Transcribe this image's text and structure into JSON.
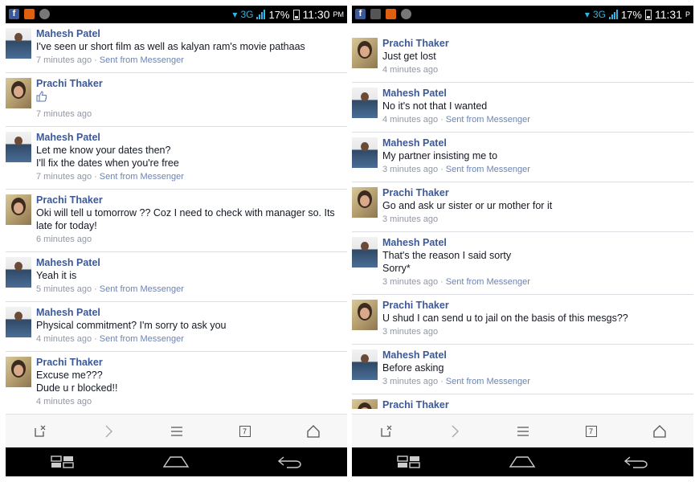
{
  "left_panel": {
    "status": {
      "network": "3G",
      "battery": "17%",
      "time": "11:30",
      "ampm": "PM"
    },
    "messages": [
      {
        "author": "Mahesh Patel",
        "avatar": "mahesh",
        "text": "I've seen ur short film as well as kalyan ram's movie pathaas",
        "time": "7 minutes ago",
        "source": "Sent from Messenger"
      },
      {
        "author": "Prachi Thaker",
        "avatar": "prachi",
        "like": true,
        "time": "7 minutes ago"
      },
      {
        "author": "Mahesh Patel",
        "avatar": "mahesh",
        "text": "Let me know your dates then?\nI'll fix the dates when you're free",
        "time": "7 minutes ago",
        "source": "Sent from Messenger"
      },
      {
        "author": "Prachi Thaker",
        "avatar": "prachi",
        "text": "Oki will tell u tomorrow ?? Coz I need to check with manager so. Its late for today!",
        "time": "6 minutes ago"
      },
      {
        "author": "Mahesh Patel",
        "avatar": "mahesh",
        "text": "Yeah it is",
        "time": "5 minutes ago",
        "source": "Sent from Messenger"
      },
      {
        "author": "Mahesh Patel",
        "avatar": "mahesh",
        "text": "Physical commitment? I'm sorry to ask you",
        "time": "4 minutes ago",
        "source": "Sent from Messenger"
      },
      {
        "author": "Prachi Thaker",
        "avatar": "prachi",
        "text": "Excuse me???\nDude u r blocked!!",
        "time": "4 minutes ago"
      }
    ],
    "toolbar": {
      "tabs_count": "7"
    }
  },
  "right_panel": {
    "status": {
      "network": "3G",
      "battery": "17%",
      "time": "11:31",
      "ampm": "P"
    },
    "messages": [
      {
        "author": "Prachi Thaker",
        "avatar": "prachi",
        "text": "Just get lost",
        "time": "4 minutes ago"
      },
      {
        "author": "Mahesh Patel",
        "avatar": "mahesh",
        "text": "No it's not that I wanted",
        "time": "4 minutes ago",
        "source": "Sent from Messenger"
      },
      {
        "author": "Mahesh Patel",
        "avatar": "mahesh",
        "text": "My partner insisting me to",
        "time": "3 minutes ago",
        "source": "Sent from Messenger"
      },
      {
        "author": "Prachi Thaker",
        "avatar": "prachi",
        "text": "Go and ask ur sister or ur mother for it",
        "time": "3 minutes ago"
      },
      {
        "author": "Mahesh Patel",
        "avatar": "mahesh",
        "text": "That's the reason I said sorty\nSorry*",
        "time": "3 minutes ago",
        "source": "Sent from Messenger"
      },
      {
        "author": "Prachi Thaker",
        "avatar": "prachi",
        "text": "U shud I can send u to jail on the basis of this mesgs??",
        "time": "3 minutes ago"
      },
      {
        "author": "Mahesh Patel",
        "avatar": "mahesh",
        "text": "Before asking",
        "time": "3 minutes ago",
        "source": "Sent from Messenger"
      },
      {
        "author": "Prachi Thaker",
        "avatar": "prachi"
      }
    ],
    "toolbar": {
      "tabs_count": "7"
    }
  },
  "icons": {
    "toolbar": [
      "close-tab-icon",
      "forward-icon",
      "menu-icon",
      "tabs-icon",
      "home-icon"
    ],
    "navbar": [
      "recent-apps-icon",
      "home-nav-icon",
      "back-icon"
    ]
  },
  "colors": {
    "name": "#3b5998",
    "meta": "#9197a3",
    "link": "#6d84b4",
    "status_accent": "#33b5e5"
  }
}
